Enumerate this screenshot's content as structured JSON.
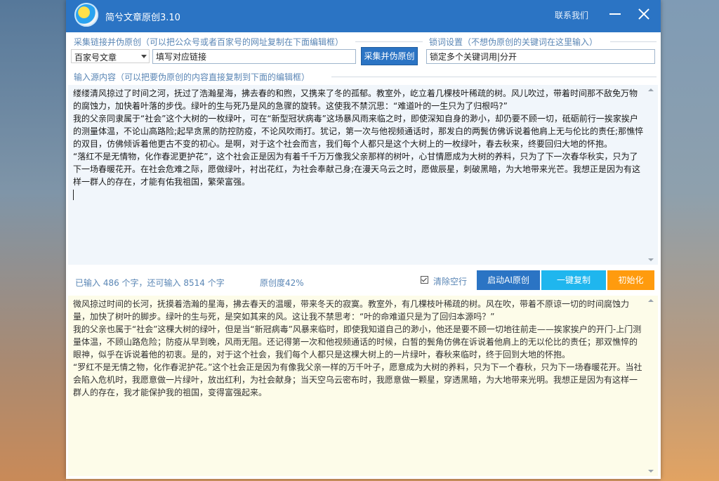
{
  "window": {
    "title": "简兮文章原创3.10",
    "contact_label": "联系我们"
  },
  "collect": {
    "label": "采集链接并伪原创（可以把公众号或者百家号的网址复制在下面编辑框）",
    "source_selected": "百家号文章",
    "link_value": "填写对应链接",
    "button_label": "采集并伪原创"
  },
  "lock": {
    "label": "锁词设置（不想伪原创的关键词在这里输入）",
    "value": "锁定多个关键词用|分开"
  },
  "input": {
    "label": "输入源内容（可以把要伪原创的内容直接复制到下面的编辑框）",
    "paragraphs": [
      "缕缕清风掠过了时间之河，抚过了浩瀚星海，拂去春的和煦，又携来了冬的孤郁。教室外，屹立着几棵枝叶稀疏的树。风儿吹过，带着时间那不敌免万物的腐蚀力，加快着叶落的步伐。绿叶的生与死乃是风的急骤的旋转。这使我不禁沉思：“难道叶的一生只为了归根吗?”",
      "我的父亲同隶属于“社会”这个大树的一枚绿叶，可在“新型冠状病毒”这场暴风雨来临之时，即使深知自身的渺小，却仍要不顾一切，砥砺前行一挨家挨户的测量体温，不论山高路险;起早贪黑的防控防疫，不论风吹雨打。犹记，第一次与他视频通话时，那发白的两鬓仿佛诉说着他肩上无与伦比的责任;那憔悴的双目，仿佛倾诉着他更古不变的初心。是啊，对于这个社会而言，我们每个人都只是这个大树上的一枚绿叶，春去秋来，终要回归大地的怀抱。",
      "“落红不是无情物，化作春泥更护花”，这个社会正是因为有着千千万万像我父亲那样的树叶，心甘情愿成为大树的养料，只为了下一次春华秋实，只为了下一场春暖花开。在社会危难之际，愿做绿叶，衬出花红，为社会奉献己身;在漫天乌云之时，愿做辰星，刺破黑暗，为大地带来光芒。我想正是因为有这样一群人的存在，才能有佑我祖国，繁荣富强。"
    ]
  },
  "status": {
    "count_text": "已输入 486 个字，还可输入 8514 个字",
    "originality_text": "原创度42%",
    "clear_blank_label": "清除空行",
    "clear_blank_checked": true
  },
  "actions": {
    "ai_label": "启动AI原创",
    "copy_label": "一键复制",
    "init_label": "初始化"
  },
  "output": {
    "paragraphs": [
      "微风掠过时间的长河，抚摸着浩瀚的星海，拂去春天的温暖，带来冬天的寂寞。教室外，有几棵枝叶稀疏的树。风在吹，带着不原谅一切的时间腐蚀力量，加快了树叶的脚步。绿叶的生与死，是突如其来的风。这让我不禁思考：“叶的命难道只是为了回归本源吗？”",
      "我的父亲也属于“社会”这棵大树的绿叶，但是当“新冠病毒”风暴来临时，即使我知道自己的渺小，他还是要不顾一切地往前走——挨家挨户的开门-上门测量体温，不顾山路危险；防疫从早到晚，风雨无阻。还记得第一次和他视频通话的时候，白皙的鬓角仿佛在诉说着他肩上的无以伦比的责任；那双憔悴的眼神，似乎在诉说着他的初衷。是的，对于这个社会，我们每个人都只是这棵大树上的一片绿叶，春秋来临时，终于回到大地的怀抱。",
      "“罗红不是无情之物，化作春泥护花。”这个社会正是因为有像我父亲一样的万千叶子，愿意成为大树的养料，只为下一个春秋，只为下一场春暖花开。当社会陷入危机时，我愿意做一片绿叶，放出红利，为社会献身；当天空乌云密布时，我愿意做一颗星，穿透黑暗，为大地带来光明。我想正是因为有这样一群人的存在，我才能保护我的祖国，变得富强起来。"
    ]
  },
  "colors": {
    "title_bar": "#2b74c4",
    "label_blue": "#5a86b5",
    "copy_button": "#1fb6ee",
    "init_button": "#ff9b0e",
    "source_bg": "#f1f6fb",
    "output_bg": "#fdfce9"
  }
}
